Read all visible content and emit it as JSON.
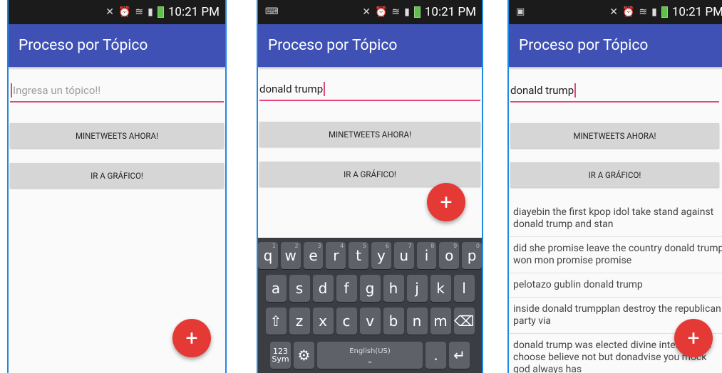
{
  "app_title": "Proceso por Tópico",
  "status_time": "10:21 PM",
  "screens": [
    {
      "search_placeholder": "Ingresa un tópico!!",
      "search_value": ""
    },
    {
      "search_value": "donald trump"
    },
    {
      "search_value": "donald trump"
    }
  ],
  "buttons": {
    "mine": "MINETWEETS AHORA!",
    "chart": "IR A GRÁFICO!"
  },
  "fab_label": "+",
  "keyboard": {
    "row1": [
      "q",
      "w",
      "e",
      "r",
      "t",
      "y",
      "u",
      "i",
      "o",
      "p"
    ],
    "row1_nums": [
      "1",
      "2",
      "3",
      "4",
      "5",
      "6",
      "7",
      "8",
      "9",
      "0"
    ],
    "row2": [
      "a",
      "s",
      "d",
      "f",
      "g",
      "h",
      "j",
      "k",
      "l"
    ],
    "row3": [
      "z",
      "x",
      "c",
      "v",
      "b",
      "n",
      "m"
    ],
    "sym_label_top": "123",
    "sym_label_bottom": "Sym",
    "space_label": "English(US)",
    "period": "."
  },
  "results": [
    "diayebin the first kpop idol take stand against donald trump and stan",
    "did she promise leave the country donald trump won  mon promise promise",
    "pelotazo  gublin  donald trump",
    "inside donald trumpplan destroy the republican party via",
    "donald trump was elected divine intervention choose believe not but donadvise you mock god always has"
  ]
}
